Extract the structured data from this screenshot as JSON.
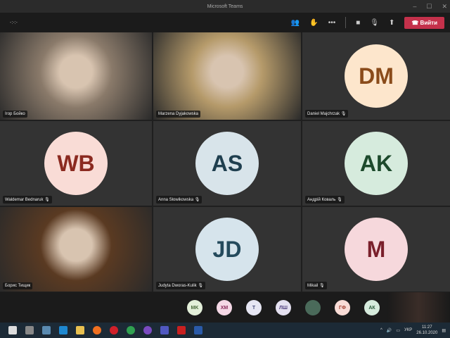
{
  "window": {
    "title": "Microsoft Teams",
    "minimize": "–",
    "maximize": "☐",
    "close": "✕"
  },
  "toolbar": {
    "timer": "-:-:-",
    "leave_label": "Вийти",
    "participants_icon": "people-icon",
    "hand_icon": "raise-hand-icon",
    "more": "•••",
    "camera_icon": "camera-icon",
    "mic_icon": "mic-off-icon",
    "share_icon": "share-icon"
  },
  "tiles": [
    {
      "name": "Ігор Бойко",
      "type": "video",
      "bg": "#8a7a6a"
    },
    {
      "name": "Marzena Dyjakowska",
      "type": "video",
      "bg": "#b59a6a"
    },
    {
      "name": "Daniel Majchrzak",
      "initials": "DM",
      "bg": "#fde6cc",
      "fg": "#8a4b1a",
      "muted": true
    },
    {
      "name": "Waldemar Bednaruk",
      "initials": "WB",
      "bg": "#f9dcd6",
      "fg": "#8b2a20",
      "muted": true
    },
    {
      "name": "Anna Słowikowska",
      "initials": "AS",
      "bg": "#d8e4ea",
      "fg": "#1f3f4f",
      "muted": true
    },
    {
      "name": "Андрій Коваль",
      "initials": "AK",
      "bg": "#d6ebdd",
      "fg": "#1d4a2c",
      "muted": true
    },
    {
      "name": "Борис Тищик",
      "type": "video",
      "bg": "#5a3a22"
    },
    {
      "name": "Judyta Dworas-Kulik",
      "initials": "JD",
      "bg": "#d6e4ec",
      "fg": "#244a5c",
      "muted": true
    },
    {
      "name": "Mikail",
      "initials": "M",
      "bg": "#f6d8dc",
      "fg": "#7a1f2b",
      "muted": true
    }
  ],
  "overflow": [
    {
      "initials": "MK",
      "bg": "#e3efd9",
      "fg": "#4a6a3a"
    },
    {
      "initials": "ХМ",
      "bg": "#f5d8e6",
      "fg": "#8a2a5a"
    },
    {
      "initials": "Т",
      "bg": "#e6e6f3",
      "fg": "#444a7a"
    },
    {
      "initials": "ЛШ",
      "bg": "#e4e0f0",
      "fg": "#4a3a7a"
    },
    {
      "initials": "",
      "bg": "#4a6a5a",
      "fg": "#fff"
    },
    {
      "initials": "ГФ",
      "bg": "#f9dcd6",
      "fg": "#a03a2a"
    },
    {
      "initials": "АК",
      "bg": "#d6ebdd",
      "fg": "#2a5a3a"
    }
  ],
  "taskbar": {
    "apps": [
      "start",
      "task-view",
      "calculator",
      "edge",
      "file-explorer",
      "firefox",
      "opera",
      "chrome",
      "viber",
      "teams",
      "acrobat",
      "word"
    ],
    "lang": "УКР",
    "time": "11:27",
    "date": "26.10.2020"
  }
}
